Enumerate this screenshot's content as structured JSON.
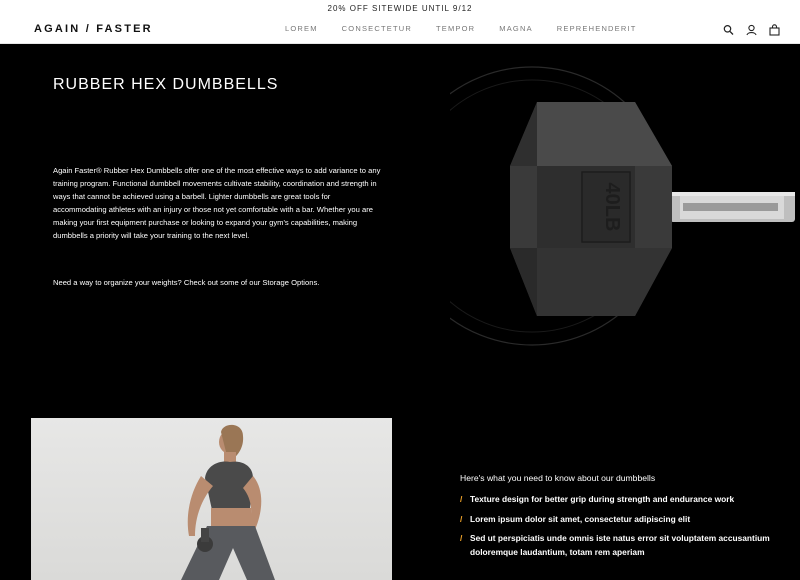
{
  "promo_banner": "20% OFF SITEWIDE UNTIL 9/12",
  "brand": {
    "logo_text": "AGAIN / FASTER"
  },
  "nav": {
    "items": [
      "LOREM",
      "CONSECTETUR",
      "TEMPOR",
      "MAGNA",
      "REPREHENDERIT"
    ]
  },
  "header_icons": [
    "search-icon",
    "account-icon",
    "cart-icon"
  ],
  "hero": {
    "title": "RUBBER HEX DUMBBELLS",
    "description": "Again Faster® Rubber Hex Dumbbells offer one of the most effective ways to add variance to any training program. Functional dumbbell movements cultivate stability, coordination and strength in ways that cannot be achieved using a barbell. Lighter dumbbells are great tools for accommodating athletes with an injury or those not yet comfortable with a bar. Whether you are making your first equipment purchase or looking to expand your gym's capabilities, making dumbbells a priority will take your training to the next level.",
    "storage_text": "Need a way to organize your weights? Check out some of our Storage Options.",
    "product_label": "40LB"
  },
  "facts": {
    "heading": "Here's what you need to know about our dumbbells",
    "items": [
      "Texture design for better grip during strength and endurance work",
      "Lorem ipsum dolor sit amet, consectetur adipiscing elit",
      "Sed ut perspiciatis unde omnis iste natus error sit voluptatem accusantium doloremque laudantium, totam rem aperiam"
    ]
  },
  "colors": {
    "accent": "#f4a62a",
    "background": "#000000",
    "text": "#ffffff"
  }
}
